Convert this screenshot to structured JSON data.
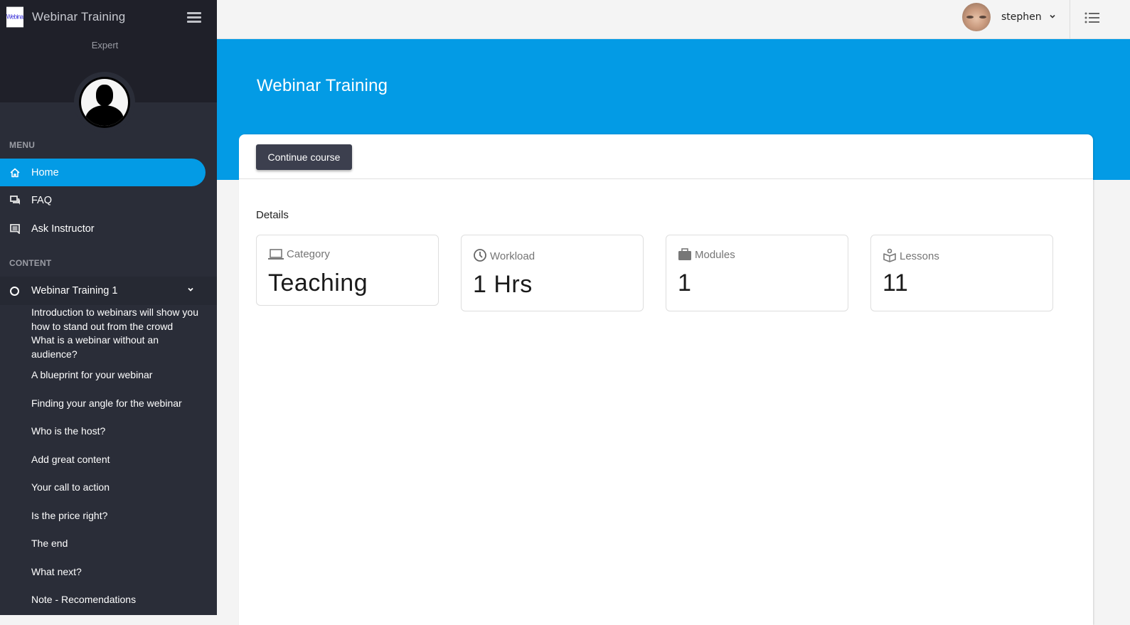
{
  "sidebar": {
    "brand_logo_text": "Webinar",
    "brand_title": "Webinar Training",
    "role": "Expert",
    "menu_label": "MENU",
    "menu_items": [
      {
        "label": "Home",
        "icon": "home-icon",
        "active": true
      },
      {
        "label": "FAQ",
        "icon": "forum-icon",
        "active": false
      },
      {
        "label": "Ask Instructor",
        "icon": "message-icon",
        "active": false
      }
    ],
    "content_label": "CONTENT",
    "module": {
      "label": "Webinar Training 1",
      "expanded": true
    },
    "lessons": [
      "Introduction to webinars will show you how to stand out from the crowd",
      "What is a webinar without an audience?",
      "A blueprint for your webinar",
      "Finding your angle for the webinar",
      "Who is the host?",
      "Add great content",
      "Your call to action",
      "Is the price right?",
      "The end",
      "What next?",
      "Note - Recomendations"
    ]
  },
  "topbar": {
    "username": "stephen"
  },
  "header": {
    "title": "Webinar Training"
  },
  "card": {
    "continue_label": "Continue course",
    "details_label": "Details",
    "stats": [
      {
        "label": "Category",
        "value": "Teaching",
        "icon": "laptop-icon"
      },
      {
        "label": "Workload",
        "value": "1 Hrs",
        "icon": "clock-icon"
      },
      {
        "label": "Modules",
        "value": "1",
        "icon": "briefcase-icon"
      },
      {
        "label": "Lessons",
        "value": "11",
        "icon": "reader-icon"
      }
    ]
  },
  "colors": {
    "accent": "#039be5",
    "sidebar_bg": "#2a2d38",
    "sidebar_top_bg": "#1f2029",
    "button_bg": "#3c3f4e"
  }
}
